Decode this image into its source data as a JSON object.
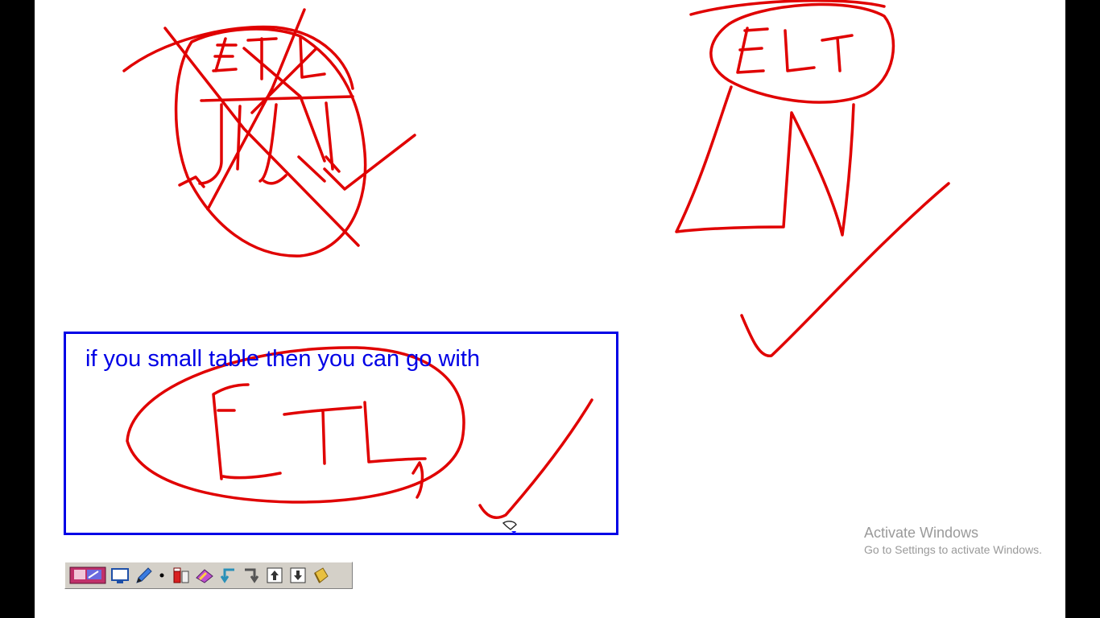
{
  "window": {
    "background": "#000000",
    "canvas_color": "#ffffff"
  },
  "ink": {
    "color": "#e00000"
  },
  "drawings": {
    "left_etl_label": "ETL",
    "right_elt_label": "ELT",
    "box_etl_label": "ETL"
  },
  "textbox": {
    "text": "if you small table then you can go with",
    "color": "#0000e6",
    "border_color": "#0000e6"
  },
  "watermark": {
    "title": "Activate Windows",
    "subtitle": "Go to Settings to activate Windows."
  },
  "toolbar": {
    "tools": [
      {
        "name": "screen-mode-tool",
        "icon": "screen-mode-icon"
      },
      {
        "name": "whiteboard-tool",
        "icon": "monitor-icon"
      },
      {
        "name": "pen-tool",
        "icon": "pen-icon"
      },
      {
        "name": "dot-size-tool",
        "icon": "dot-icon"
      },
      {
        "name": "marker-tool",
        "icon": "marker-icon"
      },
      {
        "name": "eraser-tool",
        "icon": "eraser-icon"
      },
      {
        "name": "undo-tool",
        "icon": "undo-arrow-icon"
      },
      {
        "name": "redo-tool",
        "icon": "redo-arrow-icon"
      },
      {
        "name": "page-up-tool",
        "icon": "page-up-icon"
      },
      {
        "name": "page-down-tool",
        "icon": "page-down-icon"
      },
      {
        "name": "clear-tool",
        "icon": "bucket-icon"
      }
    ]
  }
}
